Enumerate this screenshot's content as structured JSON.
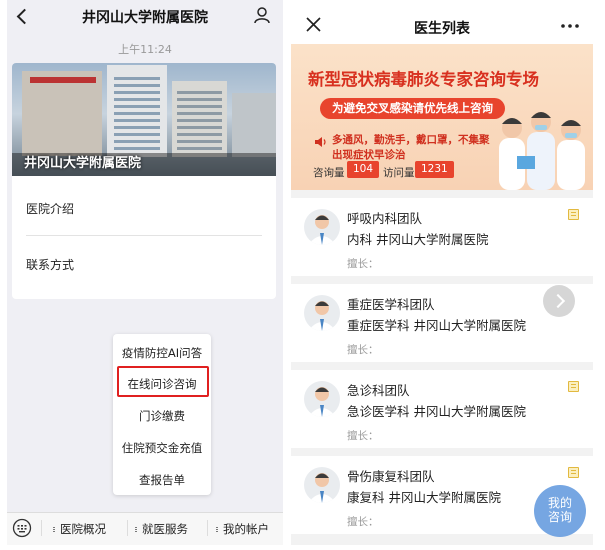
{
  "left": {
    "header": {
      "title": "井冈山大学附属医院"
    },
    "time": "上午11:24",
    "banner_title": "井冈山大学附属医院",
    "menu_items": [
      {
        "label": "医院介绍"
      },
      {
        "label": "联系方式"
      }
    ],
    "popup_items": [
      {
        "label": "疫情防控AI问答"
      },
      {
        "label": "在线问诊咨询"
      },
      {
        "label": "门诊缴费"
      },
      {
        "label": "住院预交金充值"
      },
      {
        "label": "查报告单"
      }
    ],
    "bottom_tabs": [
      {
        "label": "医院概况"
      },
      {
        "label": "就医服务"
      },
      {
        "label": "我的帐户"
      }
    ]
  },
  "right": {
    "header": {
      "title": "医生列表"
    },
    "promo": {
      "title": "新型冠状病毒肺炎专家咨询专场",
      "pill": "为避免交叉感染请优先线上咨询",
      "line1": "多通风，勤洗手，戴口罩，不集聚",
      "line2": "出现症状早诊治",
      "consult_label": "咨询量",
      "consult_value": "104",
      "visit_label": "访问量",
      "visit_value": "1231"
    },
    "doctors": [
      {
        "name": "呼吸内科团队",
        "dept": "内科  井冈山大学附属医院",
        "spec": "擅长："
      },
      {
        "name": "重症医学科团队",
        "dept": "重症医学科  井冈山大学附属医院",
        "spec": "擅长："
      },
      {
        "name": "急诊科团队",
        "dept": "急诊医学科  井冈山大学附属医院",
        "spec": "擅长："
      },
      {
        "name": "骨伤康复科团队",
        "dept": "康复科  井冈山大学附属医院",
        "spec": "擅长："
      }
    ],
    "fab": {
      "line1": "我的",
      "line2": "咨询"
    }
  },
  "colors": {
    "accent_red": "#e8442d",
    "fab_blue": "#6b9fe0",
    "highlight": "#e02020"
  }
}
